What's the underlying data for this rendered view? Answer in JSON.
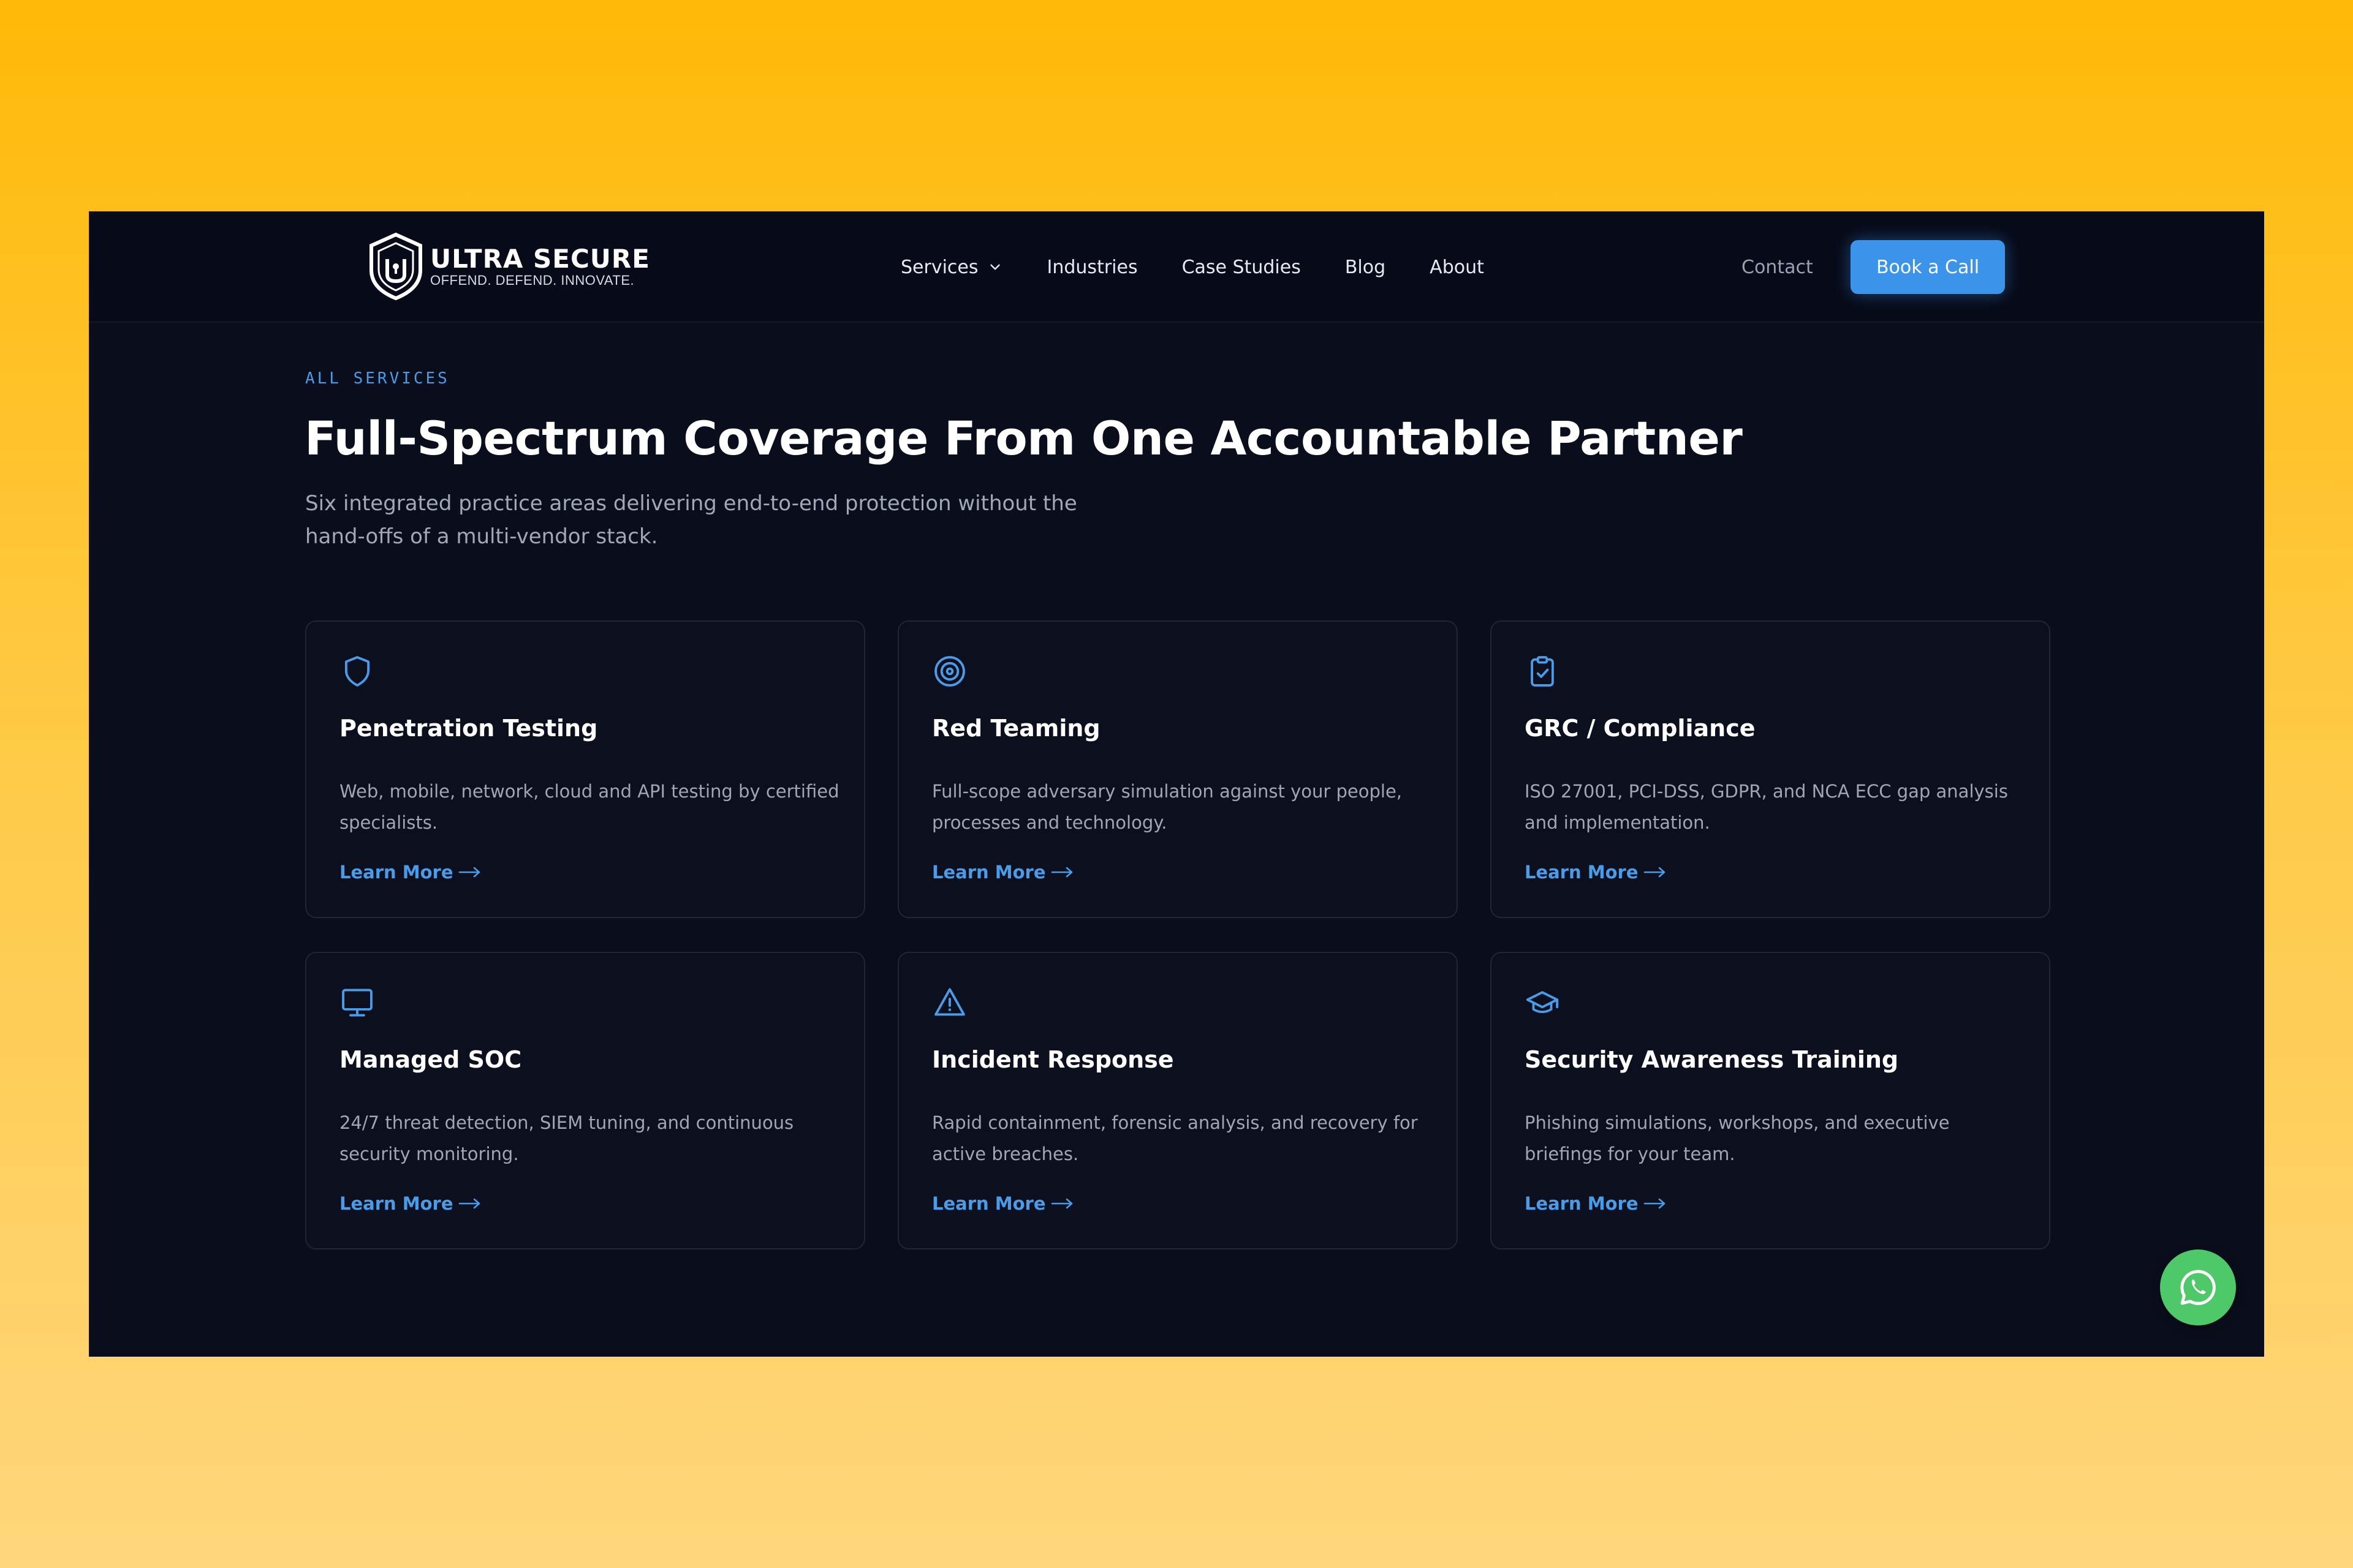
{
  "brand": {
    "name": "ULTRA SECURE",
    "tagline": "OFFEND. DEFEND. INNOVATE."
  },
  "nav": {
    "items": [
      {
        "label": "Services",
        "has_dropdown": true
      },
      {
        "label": "Industries"
      },
      {
        "label": "Case Studies"
      },
      {
        "label": "Blog"
      },
      {
        "label": "About"
      }
    ],
    "contact_label": "Contact",
    "cta_label": "Book a Call"
  },
  "hero": {
    "eyebrow": "ALL SERVICES",
    "title": "Full-Spectrum Coverage From One Accountable Partner",
    "subtitle": "Six integrated practice areas delivering end-to-end protection without the hand-offs of a multi-vendor stack."
  },
  "services": [
    {
      "icon": "shield-icon",
      "title": "Penetration Testing",
      "description": "Web, mobile, network, cloud and API testing by certified specialists.",
      "link": "Learn More"
    },
    {
      "icon": "target-icon",
      "title": "Red Teaming",
      "description": "Full-scope adversary simulation against your people, processes and technology.",
      "link": "Learn More"
    },
    {
      "icon": "clipboard-check-icon",
      "title": "GRC / Compliance",
      "description": "ISO 27001, PCI-DSS, GDPR, and NCA ECC gap analysis and implementation.",
      "link": "Learn More"
    },
    {
      "icon": "monitor-icon",
      "title": "Managed SOC",
      "description": "24/7 threat detection, SIEM tuning, and continuous security monitoring.",
      "link": "Learn More"
    },
    {
      "icon": "warning-triangle-icon",
      "title": "Incident Response",
      "description": "Rapid containment, forensic analysis, and recovery for active breaches.",
      "link": "Learn More"
    },
    {
      "icon": "graduation-cap-icon",
      "title": "Security Awareness Training",
      "description": "Phishing simulations, workshops, and executive briefings for your team.",
      "link": "Learn More"
    }
  ],
  "colors": {
    "accent": "#3b93ea",
    "link": "#4a9be8",
    "background": "#0a0e1c",
    "nav_background": "#070a18",
    "page_gradient_top": "#ffb907",
    "page_gradient_bottom": "#ffd67c",
    "whatsapp": "#4fc86a"
  }
}
